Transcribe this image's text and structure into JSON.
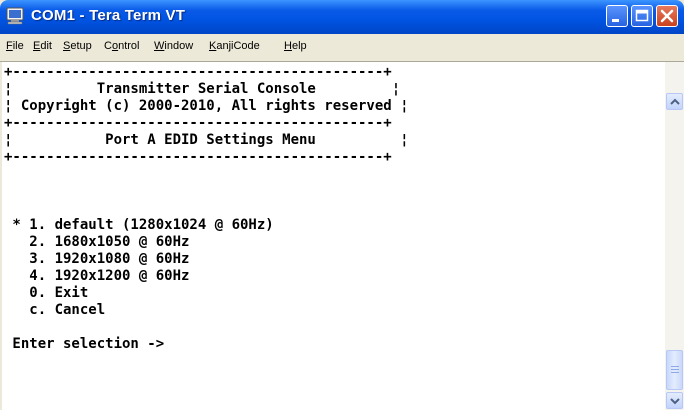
{
  "window": {
    "title": "COM1 - Tera Term VT"
  },
  "menubar": {
    "items": [
      {
        "accel": "F",
        "rest": "ile"
      },
      {
        "accel": "E",
        "rest": "dit"
      },
      {
        "accel": "S",
        "rest": "etup"
      },
      {
        "accel": "",
        "pre": "C",
        "mid": "o",
        "rest": "ntrol"
      },
      {
        "accel": "W",
        "rest": "indow"
      },
      {
        "accel": "K",
        "rest": "anjiCode"
      },
      {
        "accel": "H",
        "rest": "elp"
      }
    ]
  },
  "terminal": {
    "lines": [
      "+--------------------------------------------+",
      "¦          Transmitter Serial Console         ¦",
      "¦ Copyright (c) 2000-2010, All rights reserved ¦",
      "+--------------------------------------------+",
      "¦           Port A EDID Settings Menu          ¦",
      "+--------------------------------------------+",
      "",
      "",
      "",
      " * 1. default (1280x1024 @ 60Hz)",
      "   2. 1680x1050 @ 60Hz",
      "   3. 1920x1080 @ 60Hz",
      "   4. 1920x1200 @ 60Hz",
      "   0. Exit",
      "   c. Cancel",
      "",
      " Enter selection ->"
    ]
  }
}
